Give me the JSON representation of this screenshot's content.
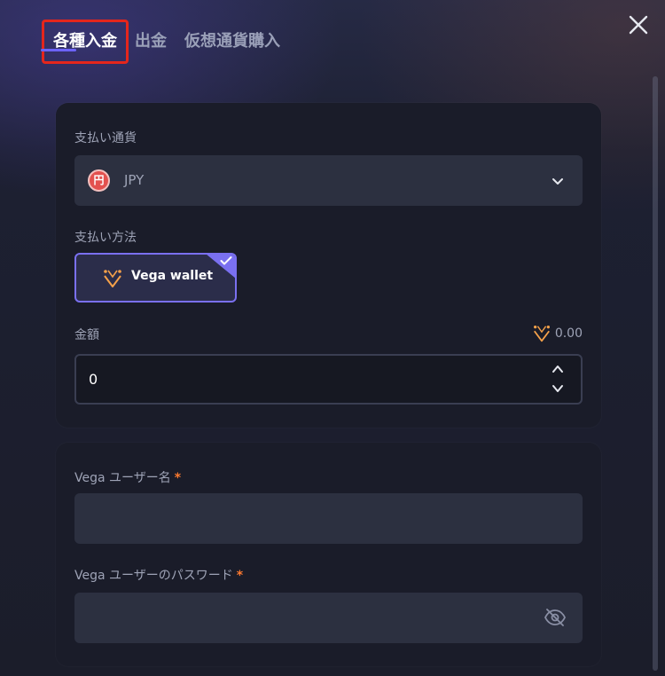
{
  "tabs": [
    {
      "label": "各種入金",
      "active": true
    },
    {
      "label": "出金",
      "active": false
    },
    {
      "label": "仮想通貨購入",
      "active": false
    }
  ],
  "icons": {
    "close": "close-icon",
    "currency": "yen-coin-icon",
    "chevron": "chevron-down-icon",
    "vega_logo": "vega-logo-icon",
    "check": "check-icon",
    "spin_up": "chevron-up-icon",
    "spin_down": "chevron-down-icon",
    "password_toggle": "eye-off-icon"
  },
  "payment_currency": {
    "label": "支払い通貨",
    "currency_symbol": "円",
    "selected": "JPY"
  },
  "payment_method": {
    "label": "支払い方法",
    "selected_label": "Vega wallet"
  },
  "amount": {
    "label": "金額",
    "balance": "0.00",
    "value": "0"
  },
  "credentials": {
    "username_label": "Vega ユーザー名",
    "password_label": "Vega ユーザーのパスワード",
    "required_mark": "*",
    "username_value": "",
    "password_value": ""
  },
  "colors": {
    "accent": "#7a70f0",
    "highlight_box": "#e5261c",
    "required": "#ff7a2f",
    "vega_orange": "#f5a14a"
  }
}
